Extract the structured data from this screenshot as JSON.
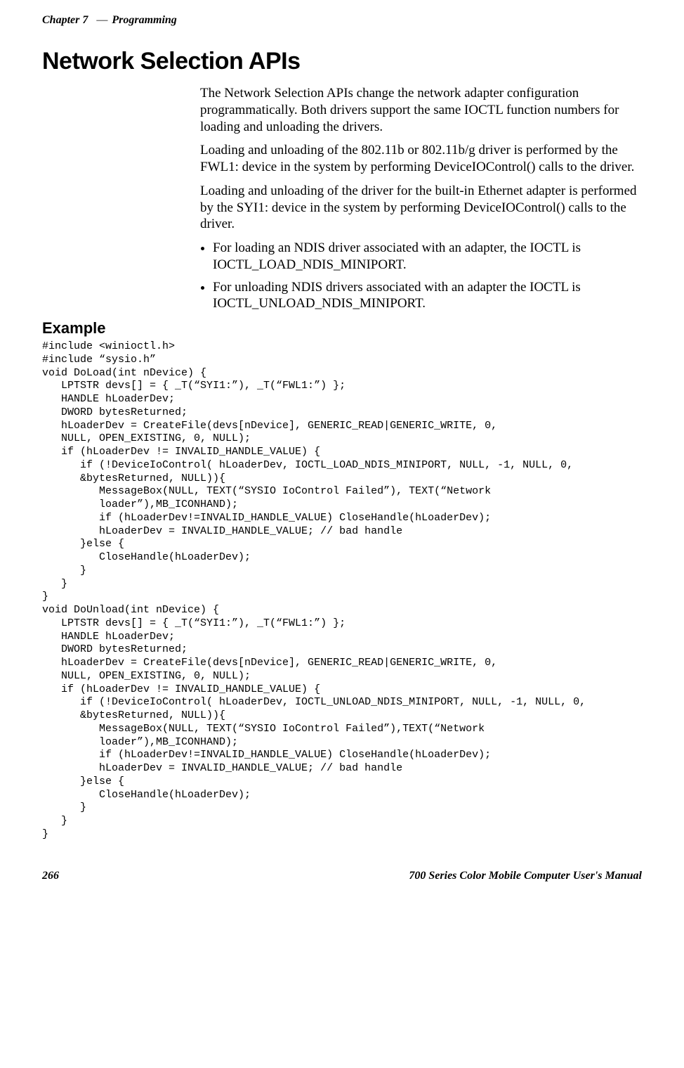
{
  "header": {
    "chapter": "Chapter 7",
    "dash": "—",
    "section": "Programming"
  },
  "title": "Network Selection APIs",
  "paragraphs": {
    "p1": "The Network Selection APIs change the network adapter configuration programmatically. Both drivers support the same IOCTL function numbers for loading and unloading the drivers.",
    "p2": "Loading and unloading of the 802.11b or 802.11b/g driver is performed by the FWL1: device in the system by performing DeviceIOControl() calls to the driver.",
    "p3": "Loading and unloading of the driver for the built-in Ethernet adapter is performed by the SYI1: device in the system by performing DeviceIOControl() calls to the driver."
  },
  "bullets": {
    "b1": "For loading an NDIS driver associated with an adapter, the IOCTL is IOCTL_LOAD_NDIS_MINIPORT.",
    "b2": "For unloading NDIS drivers associated with an adapter the IOCTL is IOCTL_UNLOAD_NDIS_MINIPORT."
  },
  "exampleHeading": "Example",
  "code": "#include <winioctl.h>\n#include “sysio.h”\nvoid DoLoad(int nDevice) {\n   LPTSTR devs[] = { _T(“SYI1:”), _T(“FWL1:”) };\n   HANDLE hLoaderDev;\n   DWORD bytesReturned;\n   hLoaderDev = CreateFile(devs[nDevice], GENERIC_READ|GENERIC_WRITE, 0,\n   NULL, OPEN_EXISTING, 0, NULL);\n   if (hLoaderDev != INVALID_HANDLE_VALUE) {\n      if (!DeviceIoControl( hLoaderDev, IOCTL_LOAD_NDIS_MINIPORT, NULL, -1, NULL, 0,\n      &bytesReturned, NULL)){\n         MessageBox(NULL, TEXT(“SYSIO IoControl Failed”), TEXT(“Network\n         loader”),MB_ICONHAND);\n         if (hLoaderDev!=INVALID_HANDLE_VALUE) CloseHandle(hLoaderDev);\n         hLoaderDev = INVALID_HANDLE_VALUE; // bad handle\n      }else {\n         CloseHandle(hLoaderDev);\n      }\n   }\n}\nvoid DoUnload(int nDevice) {\n   LPTSTR devs[] = { _T(“SYI1:”), _T(“FWL1:”) };\n   HANDLE hLoaderDev;\n   DWORD bytesReturned;\n   hLoaderDev = CreateFile(devs[nDevice], GENERIC_READ|GENERIC_WRITE, 0,\n   NULL, OPEN_EXISTING, 0, NULL);\n   if (hLoaderDev != INVALID_HANDLE_VALUE) {\n      if (!DeviceIoControl( hLoaderDev, IOCTL_UNLOAD_NDIS_MINIPORT, NULL, -1, NULL, 0,\n      &bytesReturned, NULL)){\n         MessageBox(NULL, TEXT(“SYSIO IoControl Failed”),TEXT(“Network\n         loader”),MB_ICONHAND);\n         if (hLoaderDev!=INVALID_HANDLE_VALUE) CloseHandle(hLoaderDev);\n         hLoaderDev = INVALID_HANDLE_VALUE; // bad handle\n      }else {\n         CloseHandle(hLoaderDev);\n      }\n   }\n}",
  "footer": {
    "pageNumber": "266",
    "manualTitle": "700 Series Color Mobile Computer User's Manual"
  }
}
